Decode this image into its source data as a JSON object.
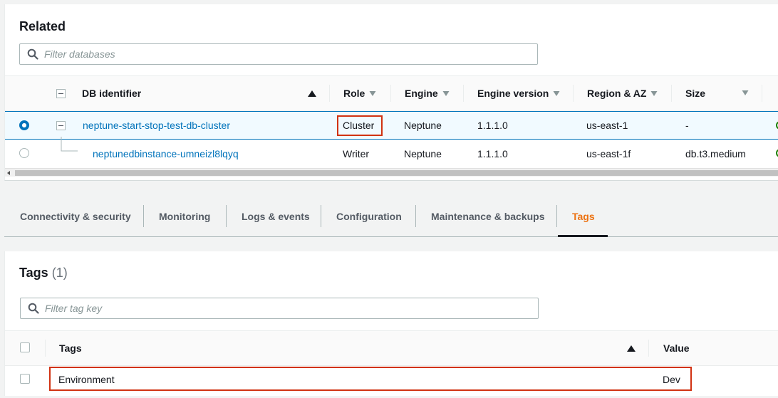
{
  "related": {
    "title": "Related",
    "filter_placeholder": "Filter databases",
    "columns": {
      "db_identifier": "DB identifier",
      "role": "Role",
      "engine": "Engine",
      "engine_version": "Engine version",
      "region_az": "Region & AZ",
      "size": "Size"
    },
    "rows": [
      {
        "identifier": "neptune-start-stop-test-db-cluster",
        "role": "Cluster",
        "engine": "Neptune",
        "engine_version": "1.1.1.0",
        "region_az": "us-east-1",
        "size": "-",
        "selected": true
      },
      {
        "identifier": "neptunedbinstance-umneizl8lqyq",
        "role": "Writer",
        "engine": "Neptune",
        "engine_version": "1.1.1.0",
        "region_az": "us-east-1f",
        "size": "db.t3.medium",
        "selected": false
      }
    ]
  },
  "tabs": [
    {
      "label": "Connectivity & security",
      "active": false
    },
    {
      "label": "Monitoring",
      "active": false
    },
    {
      "label": "Logs & events",
      "active": false
    },
    {
      "label": "Configuration",
      "active": false
    },
    {
      "label": "Maintenance & backups",
      "active": false
    },
    {
      "label": "Tags",
      "active": true
    }
  ],
  "tags": {
    "title": "Tags",
    "count": "(1)",
    "filter_placeholder": "Filter tag key",
    "columns": {
      "tags": "Tags",
      "value": "Value"
    },
    "rows": [
      {
        "key": "Environment",
        "value": "Dev"
      }
    ]
  },
  "colors": {
    "link": "#0073bb",
    "active_tab": "#ec7211",
    "highlight_box": "#d13212",
    "status_ok": "#1d8102"
  }
}
